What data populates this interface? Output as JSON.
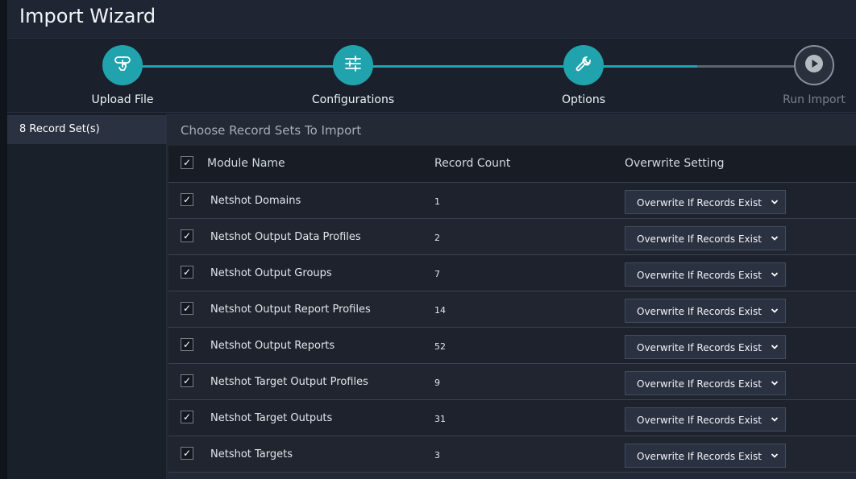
{
  "header": {
    "title": "Import Wizard"
  },
  "stepper": {
    "steps": [
      {
        "label": "Upload File",
        "state": "done",
        "icon": "hand-pointer-icon"
      },
      {
        "label": "Configurations",
        "state": "done",
        "icon": "sliders-icon"
      },
      {
        "label": "Options",
        "state": "active",
        "icon": "wrench-icon"
      },
      {
        "label": "Run Import",
        "state": "pending",
        "icon": "play-icon"
      }
    ]
  },
  "sidebar": {
    "items": [
      {
        "label": "8 Record Set(s)"
      }
    ]
  },
  "main": {
    "title": "Choose Record Sets To Import",
    "columns": {
      "module": "Module Name",
      "count": "Record Count",
      "overwrite": "Overwrite Setting"
    },
    "select_all_checked": true,
    "rows": [
      {
        "checked": true,
        "module": "Netshot Domains",
        "count": "1",
        "overwrite": "Overwrite If Records Exist"
      },
      {
        "checked": true,
        "module": "Netshot Output Data Profiles",
        "count": "2",
        "overwrite": "Overwrite If Records Exist"
      },
      {
        "checked": true,
        "module": "Netshot Output Groups",
        "count": "7",
        "overwrite": "Overwrite If Records Exist"
      },
      {
        "checked": true,
        "module": "Netshot Output Report Profiles",
        "count": "14",
        "overwrite": "Overwrite If Records Exist"
      },
      {
        "checked": true,
        "module": "Netshot Output Reports",
        "count": "52",
        "overwrite": "Overwrite If Records Exist"
      },
      {
        "checked": true,
        "module": "Netshot Target Output Profiles",
        "count": "9",
        "overwrite": "Overwrite If Records Exist"
      },
      {
        "checked": true,
        "module": "Netshot Target Outputs",
        "count": "31",
        "overwrite": "Overwrite If Records Exist"
      },
      {
        "checked": true,
        "module": "Netshot Targets",
        "count": "3",
        "overwrite": "Overwrite If Records Exist"
      }
    ]
  },
  "colors": {
    "accent": "#20a3ad",
    "muted": "#7a818c",
    "background": "#161b24"
  }
}
